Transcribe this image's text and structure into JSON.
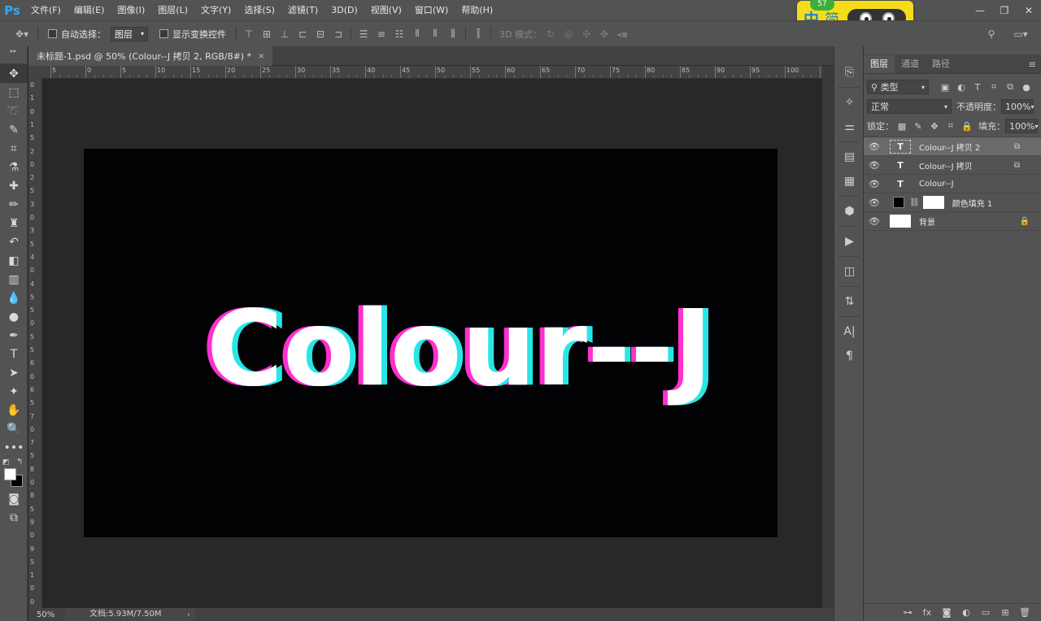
{
  "app": {
    "logo": "Ps"
  },
  "menu": [
    "文件(F)",
    "编辑(E)",
    "图像(I)",
    "图层(L)",
    "文字(Y)",
    "选择(S)",
    "滤镜(T)",
    "3D(D)",
    "视图(V)",
    "窗口(W)",
    "帮助(H)"
  ],
  "window_controls": [
    "—",
    "❐",
    "✕"
  ],
  "ime": {
    "badge": "57",
    "mode1": "中",
    "mode2": "简"
  },
  "options": {
    "auto_select_label": "自动选择：",
    "auto_select_value": "图层",
    "show_transform_label": "显示变换控件",
    "mode_3d_label": "3D 模式："
  },
  "document": {
    "tab_title": "未标题-1.psd @ 50% (Colour--J 拷贝 2, RGB/8#) *",
    "close": "×",
    "canvas_text": "Colour--J",
    "canvas_bg": "#020103",
    "text_color": "#ffffff",
    "glitch_left_color": "#ff2fd0",
    "glitch_right_color": "#28e6e6"
  },
  "ruler": {
    "top_labels": [
      "5",
      "0",
      "5",
      "10",
      "15",
      "20",
      "25",
      "30",
      "35",
      "40",
      "45",
      "50",
      "55",
      "60",
      "65",
      "70",
      "75",
      "80",
      "85",
      "90",
      "95",
      "100",
      "10"
    ],
    "left_labels": [
      "0",
      "1",
      "0",
      "1",
      "5",
      "2",
      "0",
      "2",
      "5",
      "3",
      "0",
      "3",
      "5",
      "4",
      "0",
      "4",
      "5",
      "5",
      "0",
      "5",
      "5",
      "6",
      "0",
      "6",
      "5",
      "7",
      "0",
      "7",
      "5",
      "8",
      "0",
      "8",
      "5",
      "9",
      "0",
      "9",
      "5",
      "1",
      "0",
      "0"
    ]
  },
  "status": {
    "zoom": "50%",
    "doc_info": "文档:5.93M/7.50M",
    "arrow": "›"
  },
  "layers_panel": {
    "tabs": [
      "图层",
      "通道",
      "路径"
    ],
    "filter_label": "类型",
    "blend_mode": "正常",
    "opacity_label": "不透明度：",
    "opacity_value": "100%",
    "lock_label": "锁定：",
    "fill_label": "填充：",
    "fill_value": "100%",
    "layers": [
      {
        "name": "Colour--J 拷贝 2",
        "type": "text",
        "selected": true
      },
      {
        "name": "Colour--J 拷贝",
        "type": "text",
        "selected": false
      },
      {
        "name": "Colour--J",
        "type": "text",
        "selected": false
      },
      {
        "name": "颜色填充 1",
        "type": "fill",
        "selected": false
      },
      {
        "name": "背景",
        "type": "background",
        "selected": false
      }
    ],
    "bottom_icons": [
      "link-icon",
      "fx-icon",
      "mask-icon",
      "adjustment-icon",
      "group-icon",
      "new-layer-icon",
      "trash-icon"
    ],
    "fx_text": "fx"
  },
  "glyphs": {
    "eye": "👁",
    "t": "T",
    "lock": "🔒",
    "chain": "⛓"
  }
}
